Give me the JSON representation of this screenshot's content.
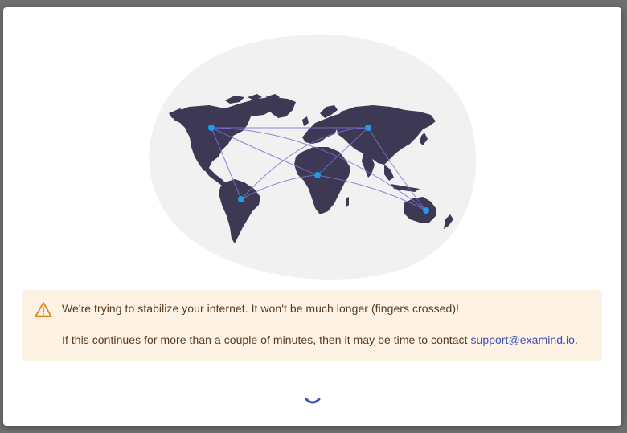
{
  "dialog": {
    "illustration": {
      "icon": "world-network-map"
    },
    "warning": {
      "icon": "warning-triangle-icon",
      "line1": "We're trying to stabilize your internet. It won't be much longer (fingers crossed)!",
      "line2_prefix": "If this continues for more than a couple of minutes, then it may be time to contact ",
      "email": "support@examind.io",
      "line2_suffix": "."
    },
    "spinner": {
      "icon": "loading-spinner"
    }
  },
  "colors": {
    "banner_bg": "#fdf2e4",
    "banner_text": "#5a3b1e",
    "warning_accent": "#e8821e",
    "link": "#3f51b5",
    "map_land": "#3d3854",
    "map_dot": "#1e9be9",
    "map_line": "#7b72d8",
    "blob": "#f1f1f1",
    "spinner": "#3f51b5"
  }
}
